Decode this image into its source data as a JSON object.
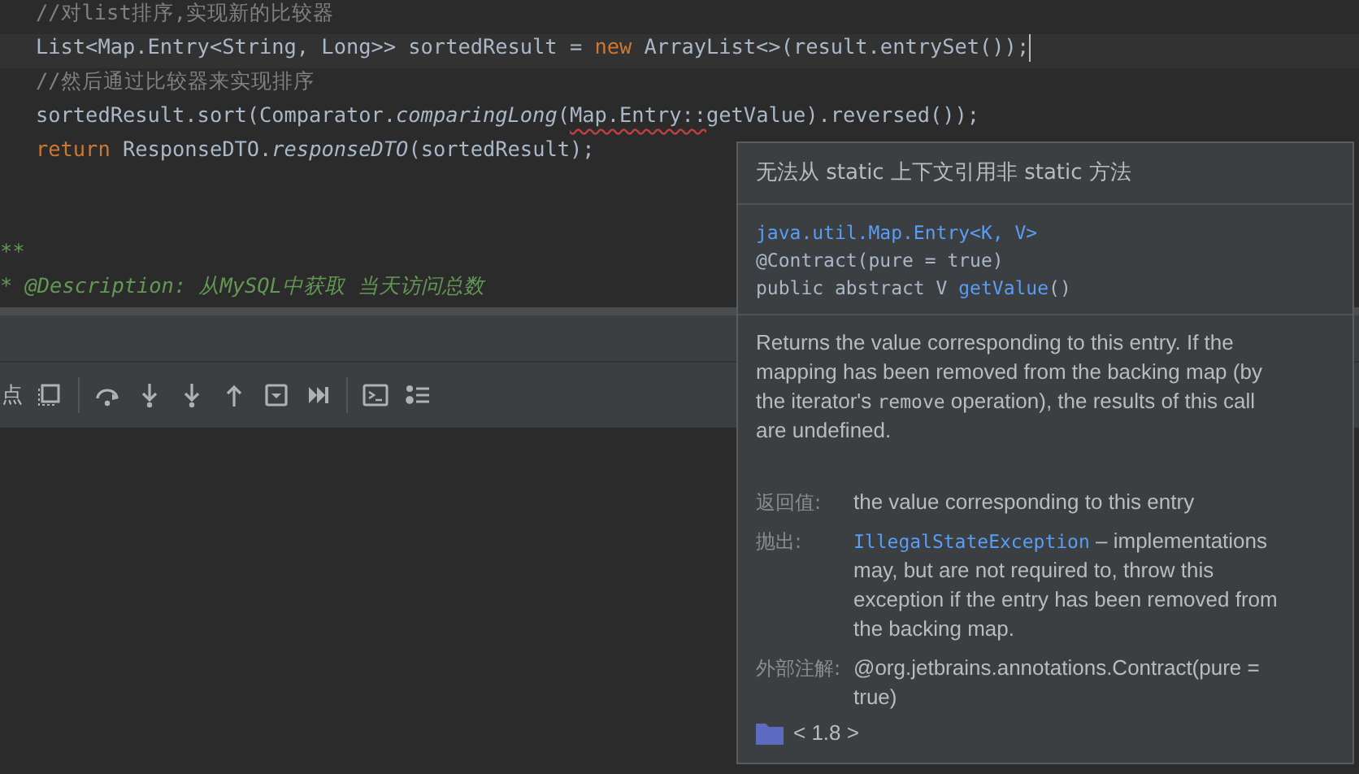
{
  "editor": {
    "lines": [
      {
        "kind": "body",
        "current": false,
        "tokens": [
          {
            "text": "//对list排序,实现新的比较器",
            "kind": "comment"
          }
        ]
      },
      {
        "kind": "body",
        "current": true,
        "tokens": [
          {
            "text": "List<Map.Entry<String, Long>> sortedResult = ",
            "kind": "plain"
          },
          {
            "text": "new",
            "kind": "keyword"
          },
          {
            "text": " ArrayList<>(result.entrySet());",
            "kind": "plain"
          }
        ]
      },
      {
        "kind": "body",
        "current": false,
        "tokens": [
          {
            "text": "//然后通过比较器来实现排序",
            "kind": "comment"
          }
        ]
      },
      {
        "kind": "body",
        "current": false,
        "tokens": [
          {
            "text": "sortedResult.sort(Comparator.",
            "kind": "plain"
          },
          {
            "text": "comparingLong",
            "kind": "italic"
          },
          {
            "text": "(",
            "kind": "plain"
          },
          {
            "text": "Map.Entry::",
            "kind": "error"
          },
          {
            "text": "getValue).reversed());",
            "kind": "plain"
          }
        ]
      },
      {
        "kind": "body",
        "current": false,
        "tokens": [
          {
            "text": "return",
            "kind": "keyword"
          },
          {
            "text": " ResponseDTO.",
            "kind": "plain"
          },
          {
            "text": "responseDTO",
            "kind": "italic"
          },
          {
            "text": "(sortedResult);",
            "kind": "plain"
          }
        ]
      },
      {
        "kind": "blank"
      },
      {
        "kind": "blank"
      },
      {
        "kind": "member",
        "current": false,
        "tokens": [
          {
            "text": "**",
            "kind": "doc"
          }
        ]
      },
      {
        "kind": "member",
        "current": false,
        "tokens": [
          {
            "text": "* @Description: 从MySQL中获取 当天访问总数",
            "kind": "doc"
          }
        ]
      }
    ]
  },
  "debug_toolbar": {
    "label": "点",
    "tools": [
      {
        "kind": "frame"
      },
      {
        "kind": "separator"
      },
      {
        "kind": "step-over"
      },
      {
        "kind": "step-into"
      },
      {
        "kind": "force-step-into"
      },
      {
        "kind": "step-out"
      },
      {
        "kind": "drop-frame"
      },
      {
        "kind": "run-to-cursor"
      },
      {
        "kind": "separator"
      },
      {
        "kind": "console"
      },
      {
        "kind": "list"
      }
    ]
  },
  "doc_popup": {
    "error": "无法从 static 上下文引用非 static 方法",
    "signature": [
      [
        {
          "text": "java.util.Map.Entry<K, V>",
          "kind": "link"
        }
      ],
      [
        {
          "text": "@Contract(pure = true)",
          "kind": "plain"
        }
      ],
      [
        {
          "text": "public abstract V ",
          "kind": "plain"
        },
        {
          "text": "getValue",
          "kind": "link"
        },
        {
          "text": "()",
          "kind": "plain"
        }
      ]
    ],
    "description": [
      {
        "text": "Returns the value corresponding to this entry. If the mapping has been removed from the backing map (by the iterator's ",
        "kind": "text"
      },
      {
        "text": "remove",
        "kind": "code"
      },
      {
        "text": " operation), the results of this call are undefined.",
        "kind": "text"
      }
    ],
    "sections": [
      {
        "label": "返回值:",
        "content": [
          {
            "text": "the value corresponding to this entry",
            "kind": "text"
          }
        ]
      },
      {
        "label": "抛出:",
        "content": [
          {
            "text": "IllegalStateException",
            "kind": "link"
          },
          {
            "text": " – implementations may, but are not required to, throw this exception if the entry has been removed from the backing map.",
            "kind": "text"
          }
        ]
      },
      {
        "label": "外部注解:",
        "content": [
          {
            "text": "@org.jetbrains.annotations.Contract(pure = true)",
            "kind": "text"
          }
        ]
      }
    ],
    "footer": "< 1.8 >"
  }
}
